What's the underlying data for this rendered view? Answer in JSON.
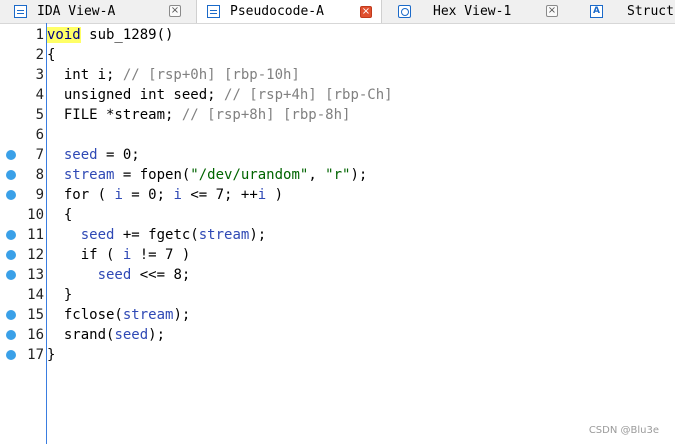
{
  "tabs": [
    {
      "label": "IDA View-A",
      "icon": "doc-icon",
      "active": false
    },
    {
      "label": "Pseudocode-A",
      "icon": "doc-icon",
      "active": true
    },
    {
      "label": "Hex View-1",
      "icon": "hex-icon",
      "active": false
    },
    {
      "label": "Struct",
      "icon": "struct-icon",
      "icon_text": "A",
      "active": false
    }
  ],
  "close_glyph": "×",
  "code": {
    "lines": [
      {
        "num": "1",
        "bp": false
      },
      {
        "num": "2",
        "bp": false
      },
      {
        "num": "3",
        "bp": false
      },
      {
        "num": "4",
        "bp": false
      },
      {
        "num": "5",
        "bp": false
      },
      {
        "num": "6",
        "bp": false
      },
      {
        "num": "7",
        "bp": true
      },
      {
        "num": "8",
        "bp": true
      },
      {
        "num": "9",
        "bp": true
      },
      {
        "num": "10",
        "bp": false
      },
      {
        "num": "11",
        "bp": true
      },
      {
        "num": "12",
        "bp": true
      },
      {
        "num": "13",
        "bp": true
      },
      {
        "num": "14",
        "bp": false
      },
      {
        "num": "15",
        "bp": true
      },
      {
        "num": "16",
        "bp": true
      },
      {
        "num": "17",
        "bp": true
      }
    ],
    "tokens": {
      "l1_void": "void",
      "l1_name": " sub_1289()",
      "l2": "{",
      "l3_a": "  int i; ",
      "l3_c": "// [rsp+0h] [rbp-10h]",
      "l4_a": "  unsigned int seed; ",
      "l4_c": "// [rsp+4h] [rbp-Ch]",
      "l5_a": "  FILE *stream; ",
      "l5_c": "// [rsp+8h] [rbp-8h]",
      "l6": "",
      "l7_v": "seed",
      "l7_b": " = 0;",
      "l8_v": "stream",
      "l8_b": " = fopen(",
      "l8_s1": "\"/dev/urandom\"",
      "l8_c": ", ",
      "l8_s2": "\"r\"",
      "l8_e": ");",
      "l9_a": "  for ( ",
      "l9_v1": "i",
      "l9_b": " = 0; ",
      "l9_v2": "i",
      "l9_c": " <= 7; ++",
      "l9_v3": "i",
      "l9_d": " )",
      "l10": "  {",
      "l11_v": "seed",
      "l11_b": " += fgetc(",
      "l11_v2": "stream",
      "l11_e": ");",
      "l12_a": "    if ( ",
      "l12_v": "i",
      "l12_b": " != 7 )",
      "l13_v": "seed",
      "l13_b": " <<= 8;",
      "l14": "  }",
      "l15_a": "  fclose(",
      "l15_v": "stream",
      "l15_e": ");",
      "l16_a": "  srand(",
      "l16_v": "seed",
      "l16_e": ");",
      "l17": "}"
    }
  },
  "watermark": "CSDN @Blu3e",
  "colors": {
    "keyword": "#000080",
    "variable": "#2f49b5",
    "string": "#006400",
    "comment": "#808080",
    "highlight": "#ffff66",
    "breakpoint": "#3aa0e8"
  }
}
